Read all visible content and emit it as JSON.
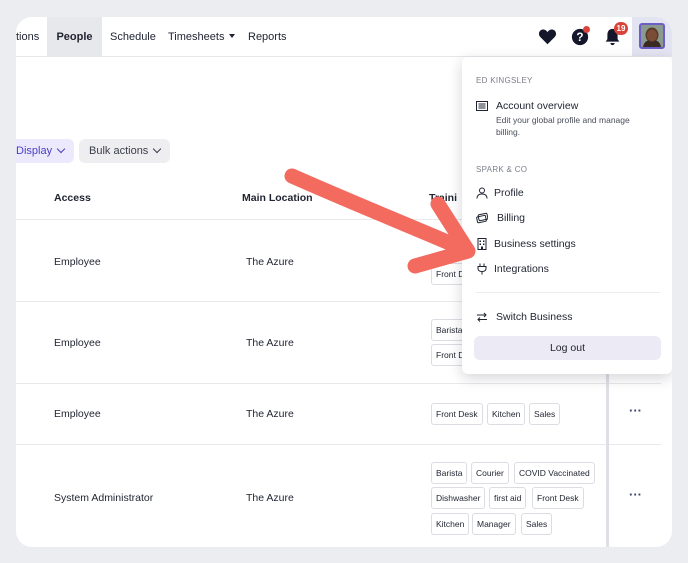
{
  "nav": {
    "items": [
      {
        "label": "tions",
        "active": false
      },
      {
        "label": "People",
        "active": true
      },
      {
        "label": "Schedule",
        "active": false
      },
      {
        "label": "Timesheets",
        "active": false,
        "dropdown": true
      },
      {
        "label": "Reports",
        "active": false
      }
    ],
    "icons": [
      "heart-icon",
      "help-icon",
      "bell-icon"
    ],
    "notification_count": "19"
  },
  "filters": {
    "display_label": "Display",
    "bulk_actions_label": "Bulk actions"
  },
  "table": {
    "headers": {
      "access": "Access",
      "main_location": "Main Location",
      "training": "Traini"
    },
    "rows": [
      {
        "access": "Employee",
        "location": "The Azure",
        "tags": [
          "Front D"
        ]
      },
      {
        "access": "Employee",
        "location": "The Azure",
        "tags": [
          "Barista",
          "Front D"
        ]
      },
      {
        "access": "Employee",
        "location": "The Azure",
        "tags": [
          "Front Desk",
          "Kitchen",
          "Sales"
        ]
      },
      {
        "access": "System Administrator",
        "location": "The Azure",
        "tags": [
          "Barista",
          "Courier",
          "COVID Vaccinated",
          "Dishwasher",
          "first aid",
          "Front Desk",
          "Kitchen",
          "Manager",
          "Sales"
        ]
      }
    ],
    "more_label": "···"
  },
  "menu": {
    "user_section": "ED KINGSLEY",
    "account_overview": "Account overview",
    "account_overview_desc": "Edit your global profile and manage billing.",
    "business_section": "SPARK & CO",
    "profile": "Profile",
    "billing": "Billing",
    "business_settings": "Business settings",
    "integrations": "Integrations",
    "switch_business": "Switch Business",
    "logout": "Log out"
  },
  "colors": {
    "accent": "#4a3fc4",
    "arrow": "#f26b5e",
    "badge": "#d9443a"
  }
}
